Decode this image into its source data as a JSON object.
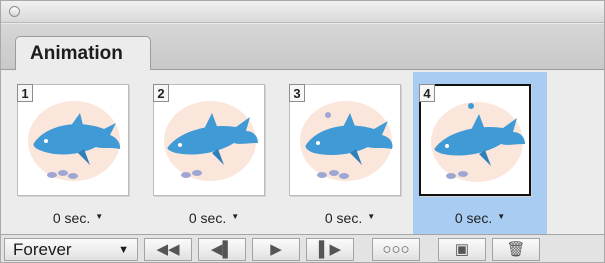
{
  "panel": {
    "tab_label": "Animation"
  },
  "frames": [
    {
      "number": "1",
      "delay": "0 sec.",
      "selected": false
    },
    {
      "number": "2",
      "delay": "0 sec.",
      "selected": false
    },
    {
      "number": "3",
      "delay": "0 sec.",
      "selected": false
    },
    {
      "number": "4",
      "delay": "0 sec.",
      "selected": true
    }
  ],
  "toolbar": {
    "loop_value": "Forever",
    "icons": [
      "select-first-frame-icon",
      "previous-frame-icon",
      "play-icon",
      "next-frame-icon",
      "tween-icon",
      "duplicate-frame-icon",
      "delete-frame-icon"
    ]
  },
  "colors": {
    "selection": "#a9cdf2",
    "dolphin": "#3f9ad6",
    "splash": "#f7d2bf",
    "bubbles": "#9ea7d4"
  }
}
